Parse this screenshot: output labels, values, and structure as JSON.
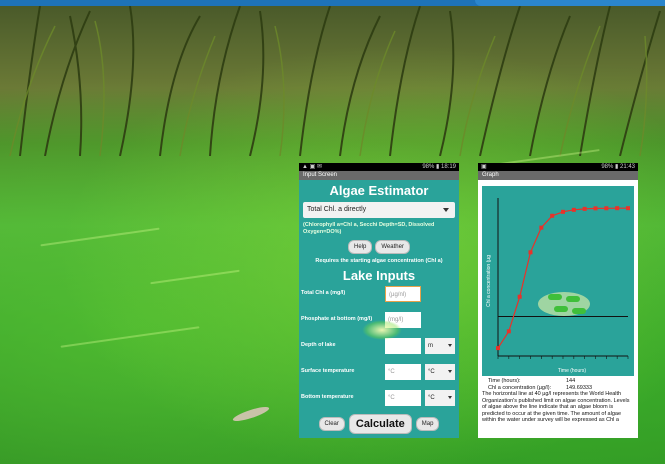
{
  "phone1": {
    "status_time": "18:19",
    "status_batt": "98%",
    "window_title": "Input Screen",
    "app_title": "Algae Estimator",
    "mode_select": "Total Chl. a directly",
    "note": "(Chlorophyll a=Chl a, Secchi Depth=SD, Dissolved Oxygen=DO%)",
    "help_label": "Help",
    "weather_label": "Weather",
    "requirement": "Requires the starting algae concentration (Chl a)",
    "lake_title": "Lake Inputs",
    "fields": [
      {
        "label": "Total Chl a (mg/l)",
        "placeholder": "(µg/nl)",
        "unit": ""
      },
      {
        "label": "Phosphate at bottom (mg/l)",
        "placeholder": "(mg/l)",
        "unit": ""
      },
      {
        "label": "Depth of lake",
        "placeholder": "",
        "unit": "m"
      },
      {
        "label": "Surface temperature",
        "placeholder": "°C",
        "unit": "°C"
      },
      {
        "label": "Bottom temperature",
        "placeholder": "°C",
        "unit": "°C"
      }
    ],
    "clear_label": "Clear",
    "calculate_label": "Calculate",
    "map_label": "Map"
  },
  "phone2": {
    "status_time": "21:43",
    "status_batt": "98%",
    "window_title": "Graph",
    "y_label": "Chl a concentration (µg",
    "x_label": "Time (hours)",
    "time_key": "Time (hours):",
    "time_val": "144",
    "chl_key": "Chl a concentration (µg/l):",
    "chl_val": "149.69333",
    "description": "The horizontal line at 40 µg/l represents the World Health Organization's published limit on algae concentration.  Levels of algae above the line indicate that an algae bloom is predicted to occur at the given time.  The amount of algae within the water under survey will be expressed as Chl a"
  },
  "chart_data": {
    "type": "line",
    "x": [
      0,
      12,
      24,
      36,
      48,
      60,
      72,
      84,
      96,
      108,
      120,
      132,
      144
    ],
    "series": [
      {
        "values": [
          8,
          25,
          60,
          105,
          130,
          142,
          146,
          148,
          149,
          149.5,
          149.6,
          149.7,
          149.7
        ]
      }
    ],
    "threshold": 40,
    "xlabel": "Time (hours)",
    "ylabel": "Chl a concentration (µg",
    "colors": {
      "line": "#e8322a",
      "background": "#2aa39a",
      "threshold": "#111111"
    }
  }
}
